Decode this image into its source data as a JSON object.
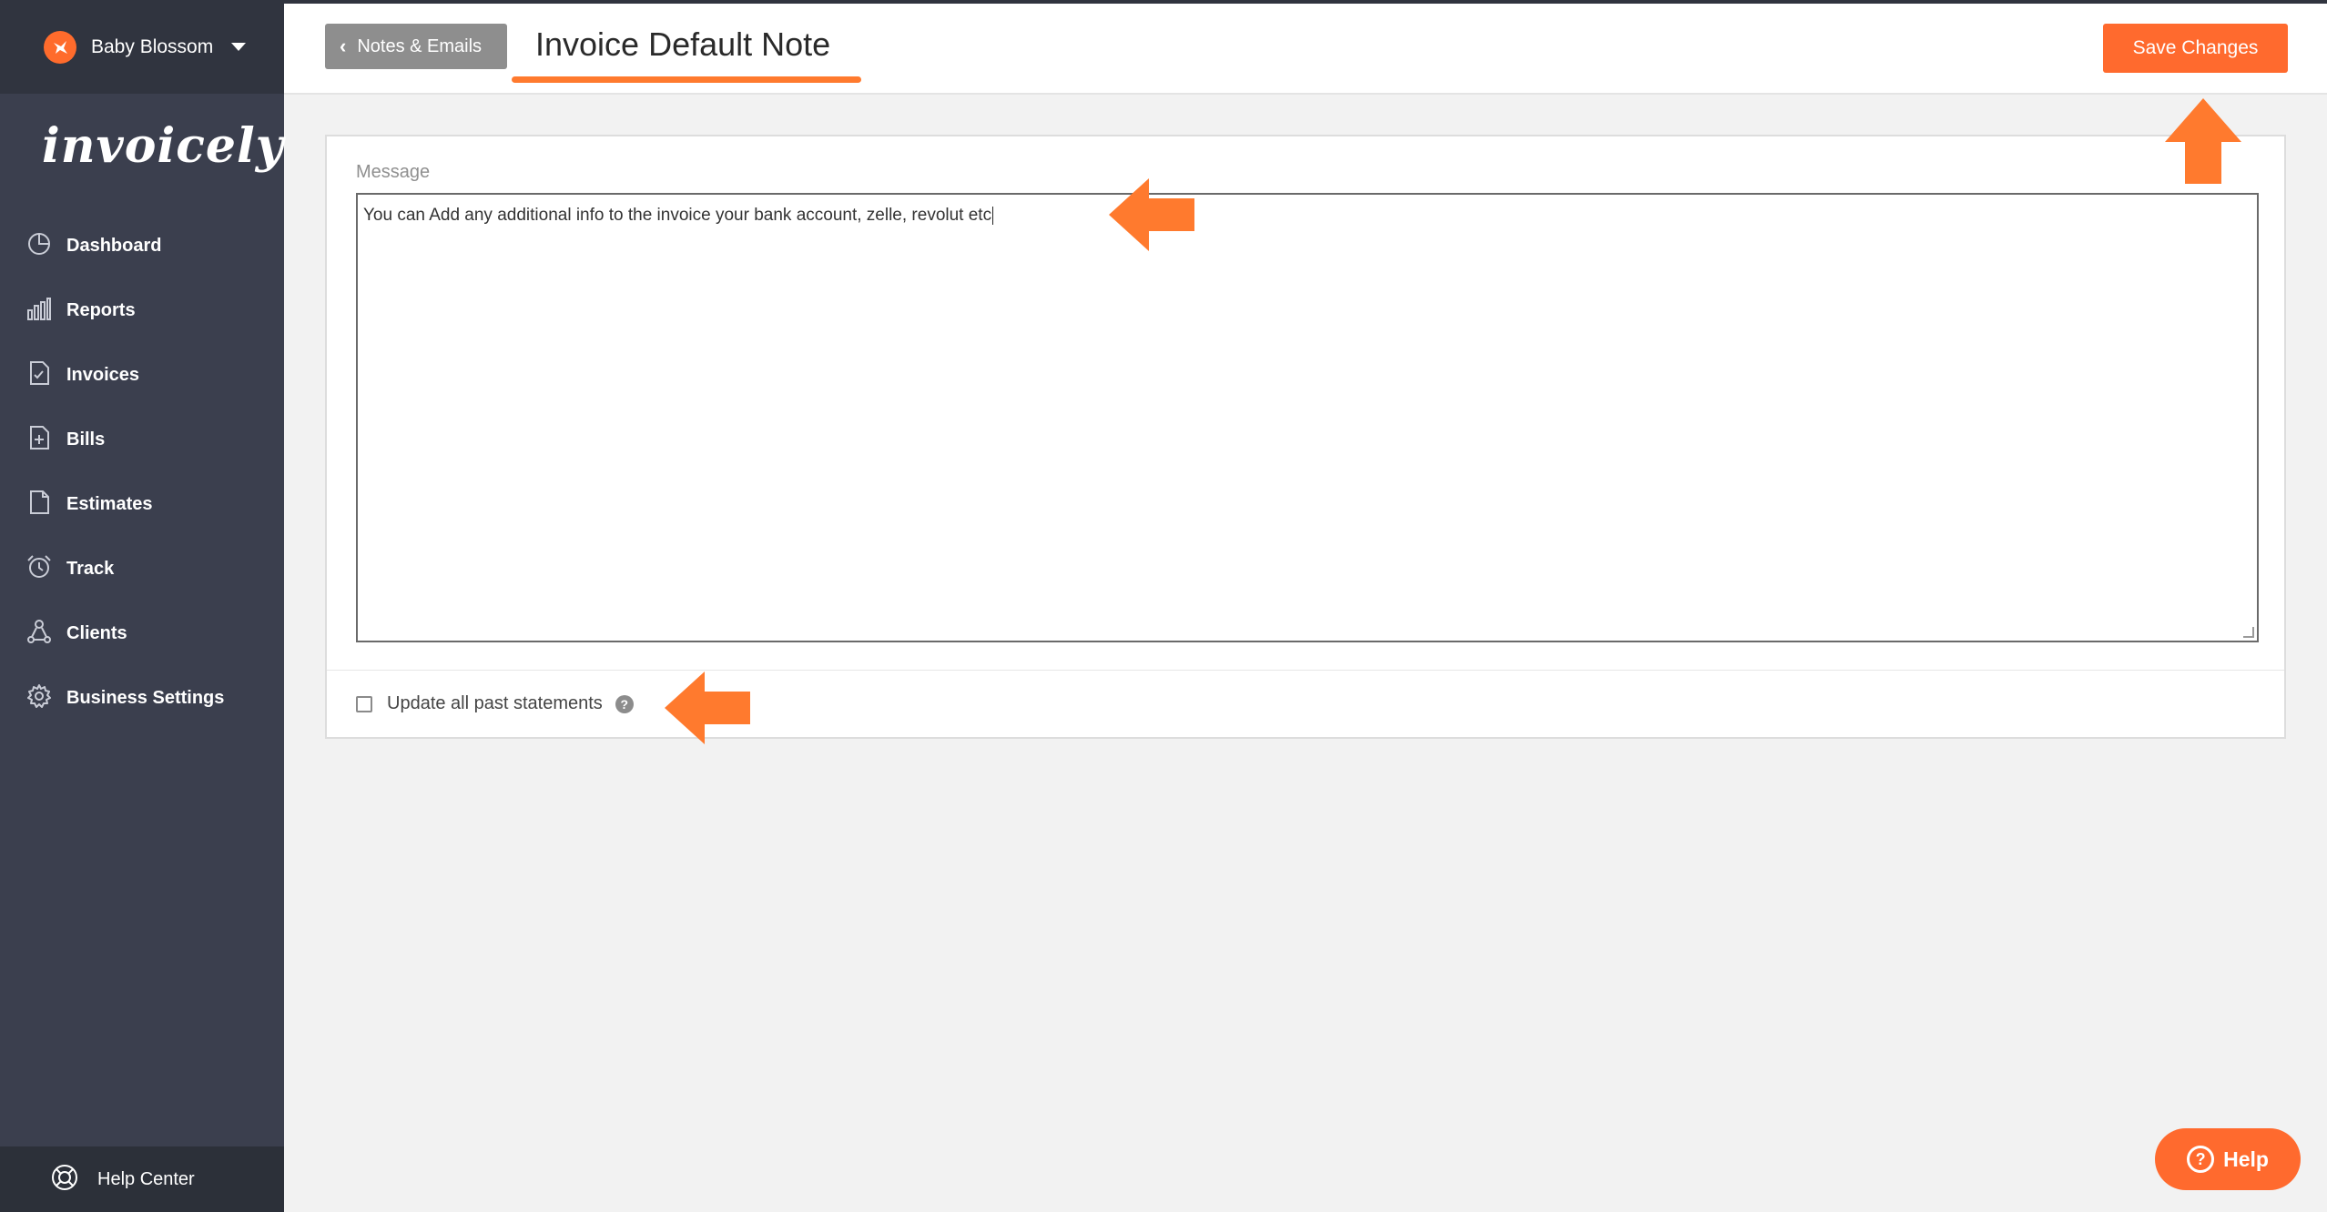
{
  "account": {
    "name": "Baby Blossom",
    "icon": "bird-logo-icon"
  },
  "brand": {
    "logo_text": "invoicely"
  },
  "sidebar": {
    "items": [
      {
        "label": "Dashboard",
        "icon": "pie-chart-icon"
      },
      {
        "label": "Reports",
        "icon": "bar-chart-icon"
      },
      {
        "label": "Invoices",
        "icon": "invoice-doc-icon"
      },
      {
        "label": "Bills",
        "icon": "bill-doc-icon"
      },
      {
        "label": "Estimates",
        "icon": "estimate-doc-icon"
      },
      {
        "label": "Track",
        "icon": "alarm-clock-icon"
      },
      {
        "label": "Clients",
        "icon": "clients-network-icon"
      },
      {
        "label": "Business Settings",
        "icon": "gear-icon"
      }
    ],
    "help_center": {
      "label": "Help Center",
      "icon": "lifebuoy-icon"
    }
  },
  "header": {
    "back_label": "Notes & Emails",
    "title": "Invoice Default Note",
    "save_label": "Save Changes"
  },
  "form": {
    "message_label": "Message",
    "message_value": "You can Add any additional info to the invoice your bank account, zelle, revolut etc",
    "checkbox_label": "Update all past statements",
    "checkbox_checked": false
  },
  "help_button": {
    "label": "Help"
  },
  "colors": {
    "accent": "#ff6a2e",
    "sidebar": "#3b3f4e",
    "sidebar_dark": "#30343f"
  }
}
